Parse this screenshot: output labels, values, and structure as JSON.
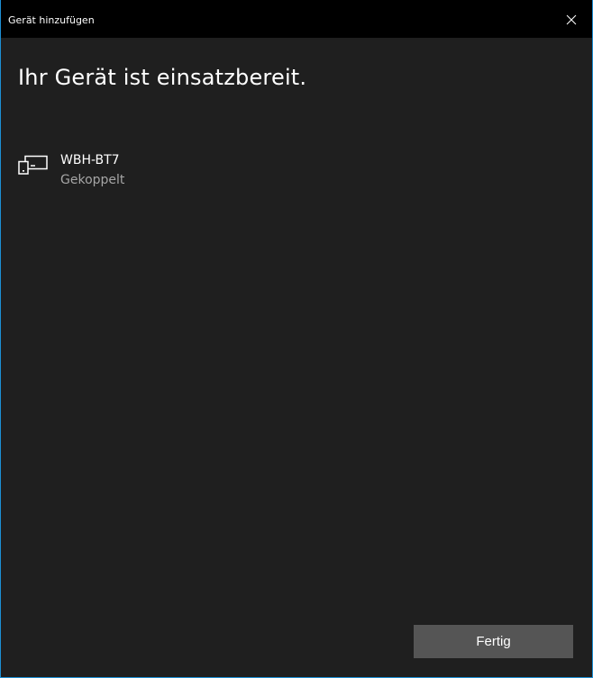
{
  "window": {
    "title": "Gerät hinzufügen",
    "close_icon": "close-icon",
    "accent_color": "#1d8fd4"
  },
  "main": {
    "heading": "Ihr Gerät ist einsatzbereit.",
    "device": {
      "icon": "device-icon",
      "name": "WBH-BT7",
      "status": "Gekoppelt"
    }
  },
  "footer": {
    "done_label": "Fertig"
  }
}
